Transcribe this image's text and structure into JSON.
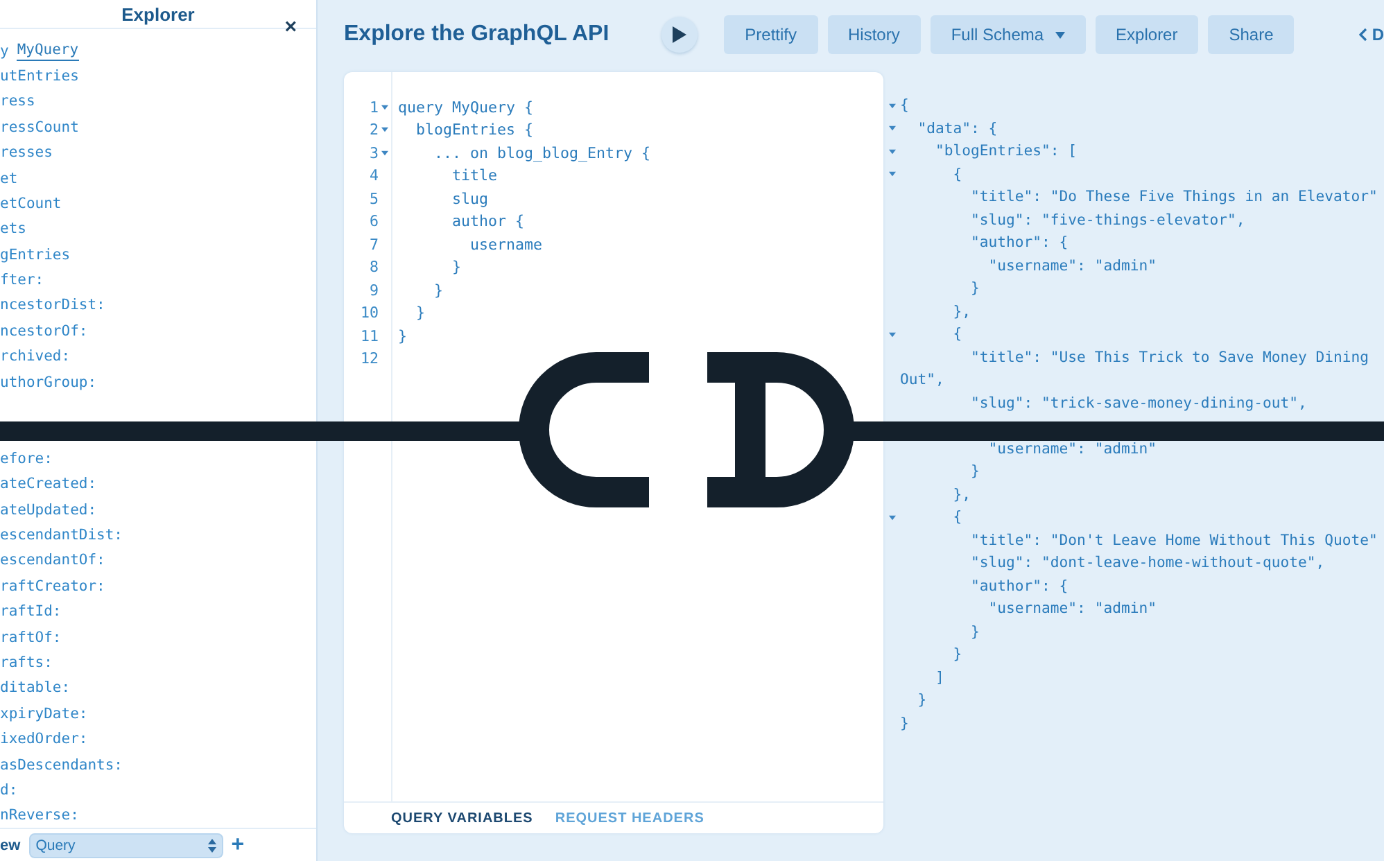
{
  "sidebar": {
    "title": "Explorer",
    "close": "×",
    "operation_keyword": "y",
    "operation_name": "MyQuery",
    "field_segments": [
      [
        "utEntries",
        "ress",
        "ressCount",
        "resses",
        "et",
        "etCount",
        "ets",
        "gEntries",
        "fter:",
        "ncestorDist:",
        "ncestorOf:",
        "rchived:",
        "uthorGroup:"
      ],
      [
        "efore:",
        "ateCreated:",
        "ateUpdated:",
        "escendantDist:",
        "escendantOf:",
        "raftCreator:",
        "raftId:",
        "raftOf:",
        "rafts:",
        "ditable:",
        "xpiryDate:",
        "ixedOrder:",
        "asDescendants:",
        "d:",
        "nReverse:"
      ]
    ],
    "footer_label": "ew",
    "operation_select": "Query",
    "add": "+"
  },
  "toolbar": {
    "title": "Explore the GraphQL API",
    "buttons": [
      {
        "label": "Prettify",
        "kind": "plain"
      },
      {
        "label": "History",
        "kind": "plain"
      },
      {
        "label": "Full Schema",
        "kind": "dropdown"
      },
      {
        "label": "Explorer",
        "kind": "plain"
      },
      {
        "label": "Share",
        "kind": "plain"
      }
    ],
    "docs_link": "D"
  },
  "editor": {
    "lines": [
      {
        "number": "1",
        "text": "query MyQuery {",
        "foldable": true
      },
      {
        "number": "2",
        "text": "  blogEntries {",
        "foldable": true
      },
      {
        "number": "3",
        "text": "    ... on blog_blog_Entry {",
        "foldable": true
      },
      {
        "number": "4",
        "text": "      title",
        "foldable": false
      },
      {
        "number": "5",
        "text": "      slug",
        "foldable": false
      },
      {
        "number": "6",
        "text": "      author {",
        "foldable": false
      },
      {
        "number": "7",
        "text": "        username",
        "foldable": false
      },
      {
        "number": "8",
        "text": "      }",
        "foldable": false
      },
      {
        "number": "9",
        "text": "    }",
        "foldable": false
      },
      {
        "number": "10",
        "text": "  }",
        "foldable": false
      },
      {
        "number": "11",
        "text": "}",
        "foldable": false
      },
      {
        "number": "12",
        "foldable": false
      }
    ],
    "tabs": [
      {
        "label": "QUERY VARIABLES",
        "selected": true
      },
      {
        "label": "REQUEST HEADERS",
        "selected": false
      }
    ]
  },
  "result": {
    "segments": [
      [
        {
          "text": "{",
          "foldable": true
        },
        {
          "text": "  \"data\": {",
          "foldable": true
        },
        {
          "text": "    \"blogEntries\": [",
          "foldable": true
        },
        {
          "text": "      {",
          "foldable": true
        },
        {
          "text": "        \"title\": \"Do These Five Things in an Elevator\"",
          "foldable": false
        },
        {
          "text": "        \"slug\": \"five-things-elevator\",",
          "foldable": false
        },
        {
          "text": "        \"author\": {",
          "foldable": false
        },
        {
          "text": "          \"username\": \"admin\"",
          "foldable": false
        },
        {
          "text": "        }",
          "foldable": false
        },
        {
          "text": "      },",
          "foldable": false
        },
        {
          "text": "      {",
          "foldable": true
        },
        {
          "text": "        \"title\": \"Use This Trick to Save Money Dining",
          "foldable": false
        },
        {
          "text": "Out\",",
          "foldable": false
        },
        {
          "text": "        \"slug\": \"trick-save-money-dining-out\",",
          "foldable": false
        }
      ],
      [
        {
          "text": "          \"username\": \"admin\"",
          "foldable": false
        },
        {
          "text": "        }",
          "foldable": false
        },
        {
          "text": "      },",
          "foldable": false
        },
        {
          "text": "      {",
          "foldable": true
        },
        {
          "text": "        \"title\": \"Don't Leave Home Without This Quote\"",
          "foldable": false
        },
        {
          "text": "        \"slug\": \"dont-leave-home-without-quote\",",
          "foldable": false
        },
        {
          "text": "        \"author\": {",
          "foldable": false
        },
        {
          "text": "          \"username\": \"admin\"",
          "foldable": false
        },
        {
          "text": "        }",
          "foldable": false
        },
        {
          "text": "      }",
          "foldable": false
        },
        {
          "text": "    ]",
          "foldable": false
        },
        {
          "text": "  }",
          "foldable": false
        },
        {
          "text": "}",
          "foldable": false
        }
      ]
    ]
  }
}
